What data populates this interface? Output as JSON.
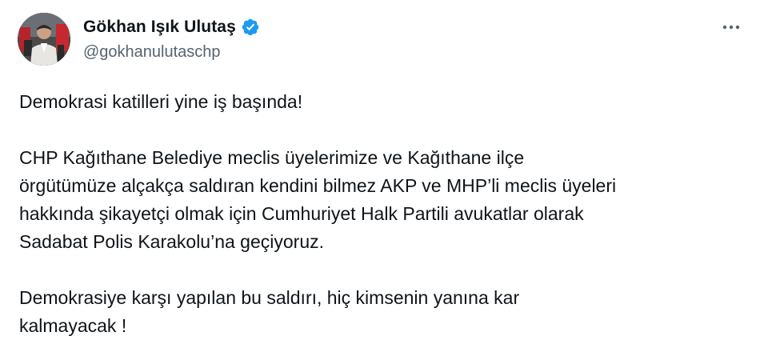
{
  "author": {
    "display_name": "Gökhan Işık Ulutaş",
    "handle": "@gokhanulutaschp",
    "verified": true,
    "verified_color": "#1d9bf0"
  },
  "icons": {
    "verified": "verified-badge-icon",
    "more": "more-options-icon"
  },
  "tweet": {
    "line1": "Demokrasi katilleri yine iş başında!",
    "para2": [
      "CHP Kağıthane Belediye meclis üyelerimize ve Kağıthane ilçe",
      "örgütümüze alçakça saldıran kendini bilmez AKP ve MHP’li meclis üyeleri",
      "hakkında şikayetçi olmak için Cumhuriyet Halk Partili avukatlar olarak",
      "Sadabat Polis Karakolu’na geçiyoruz."
    ],
    "para3": [
      "Demokrasiye karşı yapılan bu saldırı, hiç kimsenin yanına kar",
      "kalmayacak !"
    ]
  },
  "colors": {
    "text": "#0f1419",
    "secondary": "#536471",
    "accent": "#1d9bf0"
  }
}
